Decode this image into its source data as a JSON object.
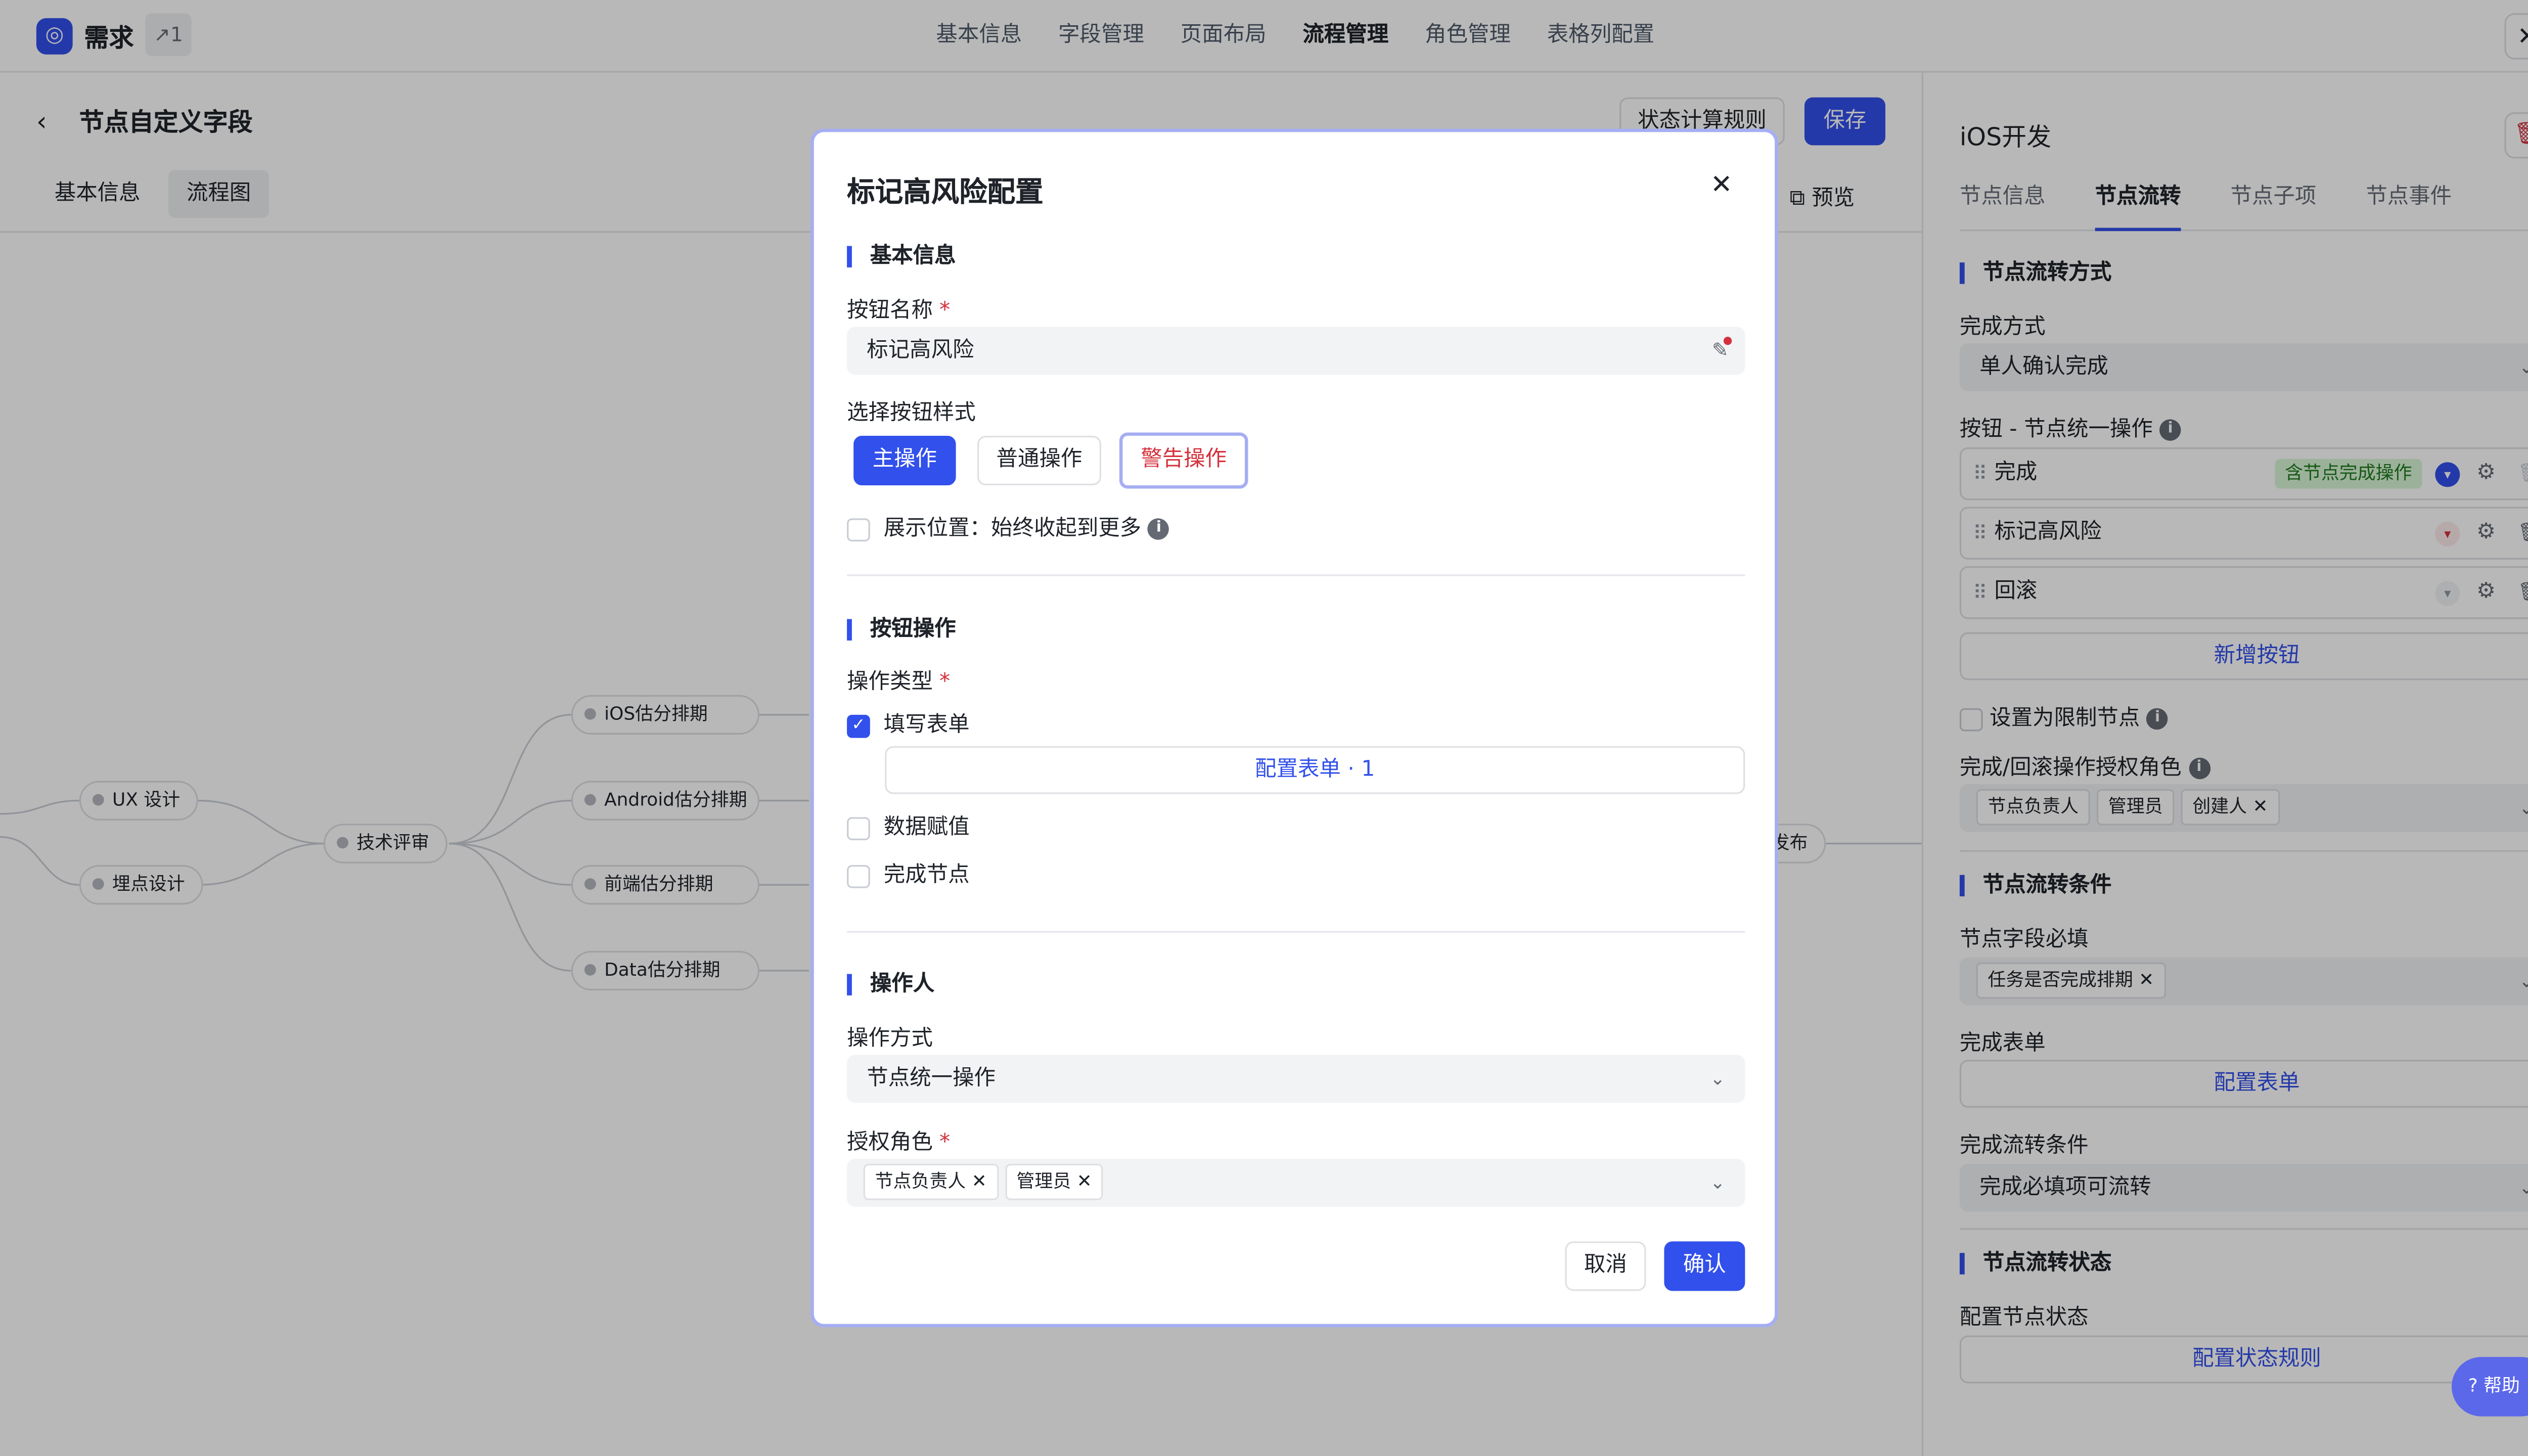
{
  "app": {
    "title": "需求",
    "link_count": "↗1",
    "close": "✕"
  },
  "topnav": [
    "基本信息",
    "字段管理",
    "页面布局",
    "流程管理",
    "角色管理",
    "表格列配置"
  ],
  "page": {
    "back": "‹",
    "title": "节点自定义字段",
    "tabs": [
      "基本信息",
      "流程图"
    ],
    "rule_button": "状态计算规则",
    "save_button": "保存",
    "preview": "预览"
  },
  "flow": {
    "nodes": [
      "UX 设计",
      "埋点设计",
      "技术评审",
      "iOS估分排期",
      "Android估分排期",
      "前端估分排期",
      "Data估分排期",
      "发布"
    ]
  },
  "right": {
    "title": "iOS开发",
    "tabs": [
      "节点信息",
      "节点流转",
      "节点子项",
      "节点事件"
    ],
    "s1": {
      "heading": "节点流转方式",
      "finish_label": "完成方式",
      "finish_value": "单人确认完成",
      "buttons_label": "按钮 - 节点统一操作",
      "rows": [
        {
          "name": "完成",
          "tag": "含节点完成操作"
        },
        {
          "name": "标记高风险"
        },
        {
          "name": "回滚"
        }
      ],
      "add_button": "新增按钮",
      "limit_label": "设置为限制节点",
      "roles_label": "完成/回滚操作授权角色",
      "roles": [
        "节点负责人",
        "管理员",
        "创建人"
      ]
    },
    "s2": {
      "heading": "节点流转条件",
      "required_label": "节点字段必填",
      "required_tag": "任务是否完成排期",
      "form_label": "完成表单",
      "form_button": "配置表单",
      "cond_label": "完成流转条件",
      "cond_value": "完成必填项可流转"
    },
    "s3": {
      "heading": "节点流转状态",
      "status_label": "配置节点状态",
      "status_button": "配置状态规则"
    }
  },
  "modal": {
    "title": "标记高风险配置",
    "close": "✕",
    "sec1": "基本信息",
    "name_label": "按钮名称",
    "name_value": "标记高风险",
    "style_label": "选择按钮样式",
    "styles": [
      "主操作",
      "普通操作",
      "警告操作"
    ],
    "position_label": "展示位置：始终收起到更多",
    "sec2": "按钮操作",
    "op_type_label": "操作类型",
    "fill_form": "填写表单",
    "config_form": "配置表单 · 1",
    "assign": "数据赋值",
    "complete": "完成节点",
    "sec3": "操作人",
    "op_mode_label": "操作方式",
    "op_mode_value": "节点统一操作",
    "auth_label": "授权角色",
    "auth_roles": [
      "节点负责人",
      "管理员"
    ],
    "cancel": "取消",
    "confirm": "确认"
  },
  "help": "帮助"
}
